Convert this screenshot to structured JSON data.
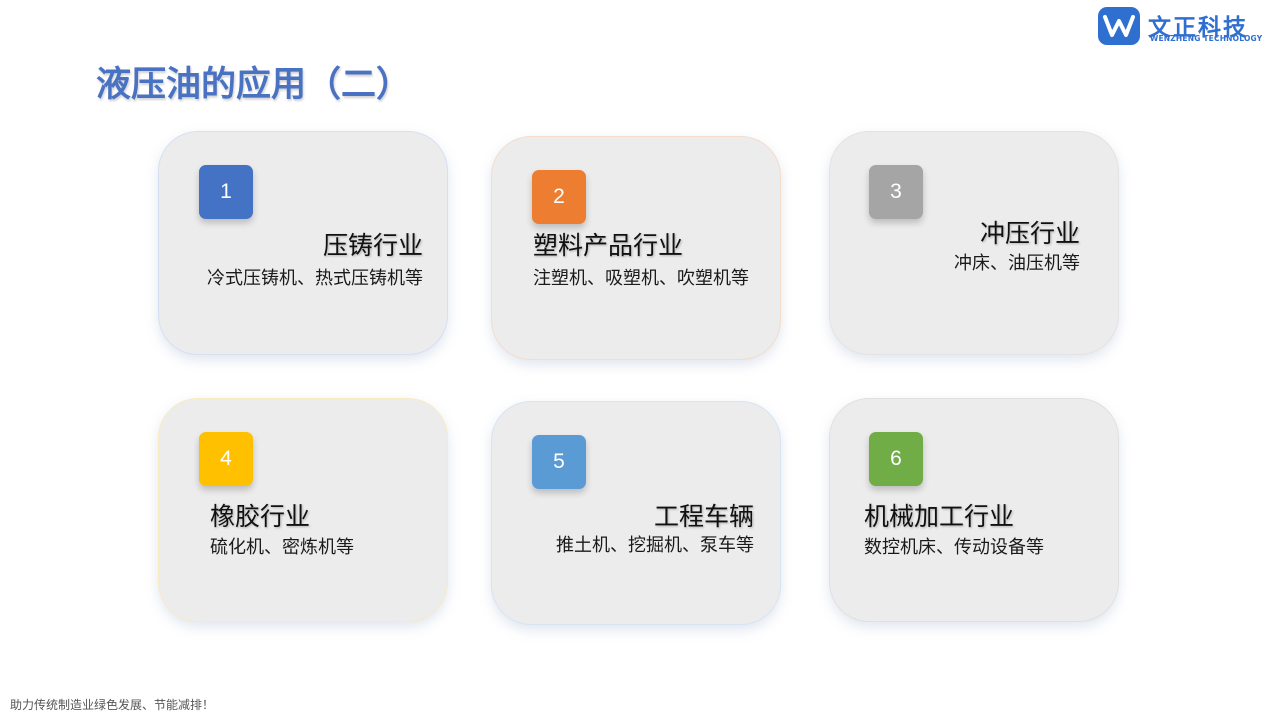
{
  "brand": {
    "name": "文正科技",
    "name_en": "WENZHENG TECHNOLOGY",
    "color": "#2f6fd0"
  },
  "title": "液压油的应用（二）",
  "cards": [
    {
      "number": "1",
      "title": "压铸行业",
      "desc": "冷式压铸机、热式压铸机等",
      "color": "#4472c4",
      "border": "#d6e0f3"
    },
    {
      "number": "2",
      "title": "塑料产品行业",
      "desc": "注塑机、吸塑机、吹塑机等",
      "color": "#ed7d31",
      "border": "#f6dccb"
    },
    {
      "number": "3",
      "title": "冲压行业",
      "desc": "冲床、油压机等",
      "color": "#a5a5a5",
      "border": "#e3e3e3"
    },
    {
      "number": "4",
      "title": "橡胶行业",
      "desc": "硫化机、密炼机等",
      "color": "#ffc000",
      "border": "#f7ebc3"
    },
    {
      "number": "5",
      "title": "工程车辆",
      "desc": "推土机、挖掘机、泵车等",
      "color": "#5b9bd5",
      "border": "#d6e4f3"
    },
    {
      "number": "6",
      "title": "机械加工行业",
      "desc": "数控机床、传动设备等",
      "color": "#70ad47",
      "border": "#e0e0e0"
    }
  ],
  "footer": "助力传统制造业绿色发展、节能减排！"
}
